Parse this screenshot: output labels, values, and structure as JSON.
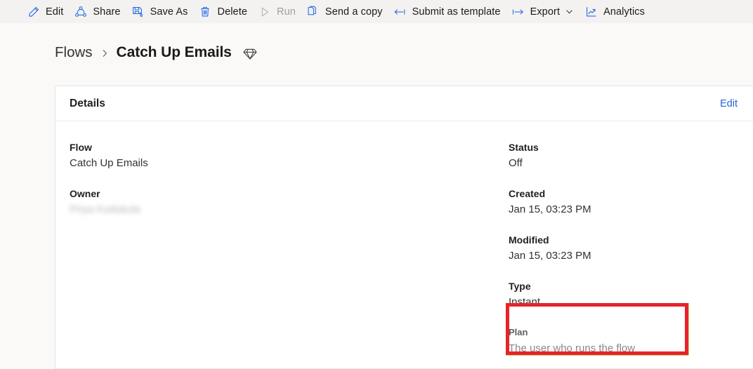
{
  "commandbar": {
    "items": [
      {
        "label": "Edit",
        "icon": "pencil-icon",
        "disabled": false
      },
      {
        "label": "Share",
        "icon": "share-network-icon",
        "disabled": false
      },
      {
        "label": "Save As",
        "icon": "save-as-icon",
        "disabled": false
      },
      {
        "label": "Delete",
        "icon": "trash-icon",
        "disabled": false
      },
      {
        "label": "Run",
        "icon": "play-icon",
        "disabled": true
      },
      {
        "label": "Send a copy",
        "icon": "copy-pages-icon",
        "disabled": false
      },
      {
        "label": "Submit as template",
        "icon": "arrow-into-bar-icon",
        "disabled": false
      },
      {
        "label": "Export",
        "icon": "bar-to-arrow-icon",
        "disabled": false,
        "chevron": "chevron-down-icon"
      },
      {
        "label": "Analytics",
        "icon": "line-chart-icon",
        "disabled": false
      }
    ]
  },
  "breadcrumb": {
    "root": "Flows",
    "separator": "›",
    "current": "Catch Up Emails",
    "badge_icon": "diamond-gem-icon"
  },
  "details": {
    "title": "Details",
    "edit_label": "Edit",
    "left_fields": [
      {
        "label": "Flow",
        "value": "Catch Up Emails",
        "blurred": false
      },
      {
        "label": "Owner",
        "value": "Priya Kodukula",
        "blurred": true
      }
    ],
    "right_fields": [
      {
        "label": "Status",
        "value": "Off"
      },
      {
        "label": "Created",
        "value": "Jan 15, 03:23 PM"
      },
      {
        "label": "Modified",
        "value": "Jan 15, 03:23 PM"
      },
      {
        "label": "Type",
        "value": "Instant"
      }
    ],
    "plan_field": {
      "label": "Plan",
      "value": "The user who runs the flow"
    }
  },
  "annotation": {
    "highlight_color": "#e8222a",
    "target": "plan-field"
  },
  "colors": {
    "accent_blue": "#2564cf",
    "icon_blue": "#2b6ce8",
    "commandbar_bg": "#f3f2f1",
    "page_bg": "#faf9f8",
    "card_bg": "#ffffff",
    "disabled_text": "#a19f9d"
  }
}
